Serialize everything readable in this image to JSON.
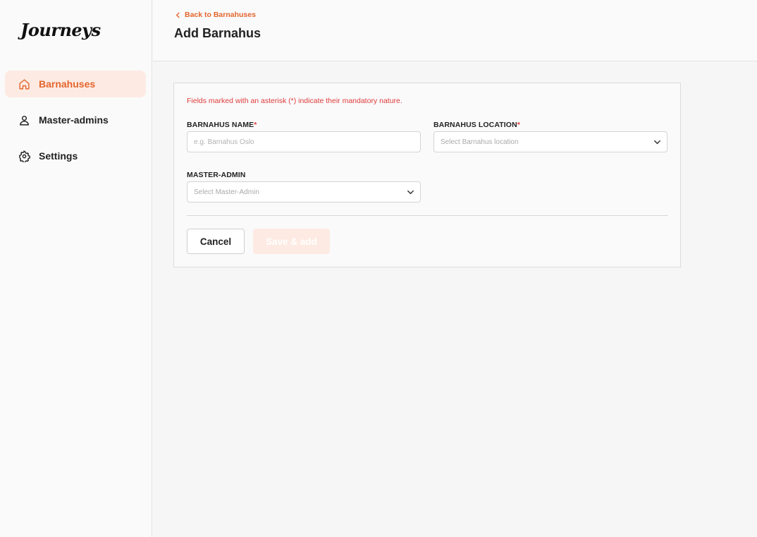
{
  "app": {
    "logo": "Journeys"
  },
  "sidebar": {
    "items": [
      {
        "label": "Barnahuses",
        "icon": "home-icon",
        "active": true
      },
      {
        "label": "Master-admins",
        "icon": "user-icon",
        "active": false
      },
      {
        "label": "Settings",
        "icon": "gear-icon",
        "active": false
      }
    ]
  },
  "header": {
    "back_link": "Back to Barnahuses",
    "title": "Add Barnahus"
  },
  "form": {
    "notice": "Fields marked with an asterisk (*) indicate their mandatory nature.",
    "name": {
      "label": "BARNAHUS NAME",
      "required_mark": "*",
      "placeholder": "e.g. Barnahus Oslo"
    },
    "location": {
      "label": "BARNAHUS LOCATION",
      "required_mark": "*",
      "placeholder": "Select Barnahus location"
    },
    "master_admin": {
      "label": "MASTER-ADMIN",
      "placeholder": "Select Master-Admin"
    },
    "cancel_label": "Cancel",
    "save_label": "Save & add"
  },
  "colors": {
    "accent": "#e4652d",
    "accent_light": "#fdeae2",
    "error": "#e03a3a"
  }
}
